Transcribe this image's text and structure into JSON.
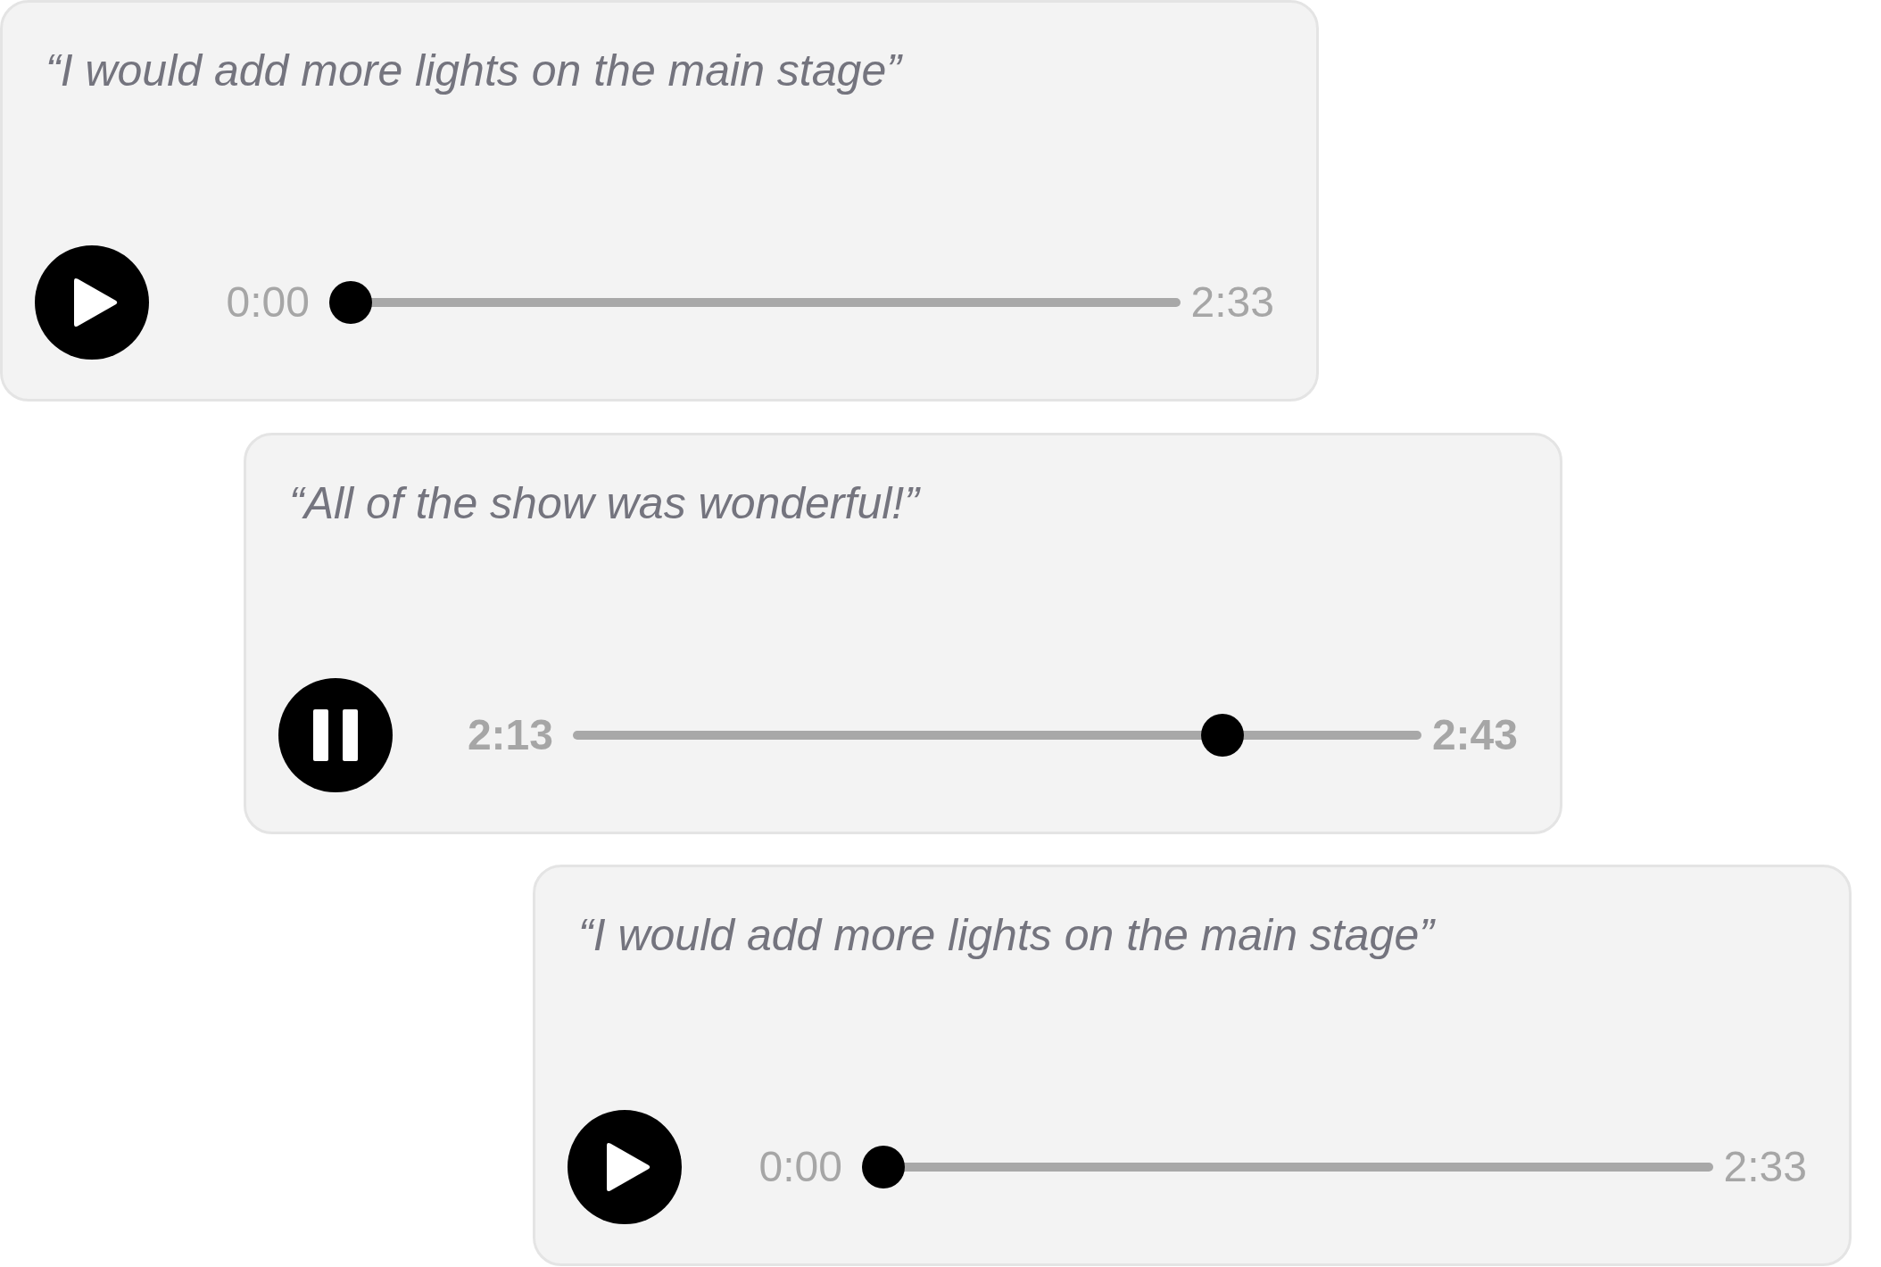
{
  "clips": [
    {
      "quote": "“I would add more lights on the main stage”",
      "playing": false,
      "current": "0:00",
      "level": 0,
      "duration": "2:33"
    },
    {
      "quote": "“All of the show was wonderful!”",
      "playing": true,
      "current": "2:13",
      "level": 0.78,
      "duration": "2:43"
    },
    {
      "quote": "“I would add more lights on the main stage”",
      "playing": false,
      "current": "0:00",
      "level": 0,
      "duration": "2:33"
    }
  ]
}
